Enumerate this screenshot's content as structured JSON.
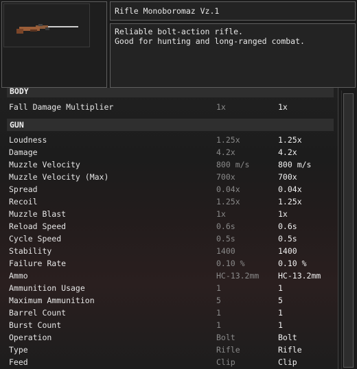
{
  "item": {
    "title": "Rifle Monoboromaz Vz.1",
    "description": [
      "Reliable bolt-action rifle.",
      "Good for hunting and long-ranged combat."
    ],
    "icon": "rifle-icon"
  },
  "sections": {
    "body": {
      "header": "BODY",
      "rows": [
        {
          "label": "Fall Damage Multiplier",
          "base": "1x",
          "current": "1x"
        }
      ]
    },
    "gun": {
      "header": "GUN",
      "rows": [
        {
          "label": "Loudness",
          "base": "1.25x",
          "current": "1.25x"
        },
        {
          "label": "Damage",
          "base": "4.2x",
          "current": "4.2x"
        },
        {
          "label": "Muzzle Velocity",
          "base": "800 m/s",
          "current": "800 m/s"
        },
        {
          "label": "Muzzle Velocity (Max)",
          "base": "700x",
          "current": "700x"
        },
        {
          "label": "Spread",
          "base": "0.04x",
          "current": "0.04x"
        },
        {
          "label": "Recoil",
          "base": "1.25x",
          "current": "1.25x"
        },
        {
          "label": "Muzzle Blast",
          "base": "1x",
          "current": "1x"
        },
        {
          "label": "Reload Speed",
          "base": "0.6s",
          "current": "0.6s"
        },
        {
          "label": "Cycle Speed",
          "base": "0.5s",
          "current": "0.5s"
        },
        {
          "label": "Stability",
          "base": "1400",
          "current": "1400"
        },
        {
          "label": "Failure Rate",
          "base": "0.10 %",
          "current": "0.10 %"
        },
        {
          "label": "Ammo",
          "base": "HC-13.2mm",
          "current": "HC-13.2mm"
        },
        {
          "label": "Ammunition Usage",
          "base": "1",
          "current": "1"
        },
        {
          "label": "Maximum Ammunition",
          "base": "5",
          "current": "5"
        },
        {
          "label": "Barrel Count",
          "base": "1",
          "current": "1"
        },
        {
          "label": "Burst Count",
          "base": "1",
          "current": "1"
        },
        {
          "label": "Operation",
          "base": "Bolt",
          "current": "Bolt"
        },
        {
          "label": "Type",
          "base": "Rifle",
          "current": "Rifle"
        },
        {
          "label": "Feed",
          "base": "Clip",
          "current": "Clip"
        }
      ]
    }
  }
}
